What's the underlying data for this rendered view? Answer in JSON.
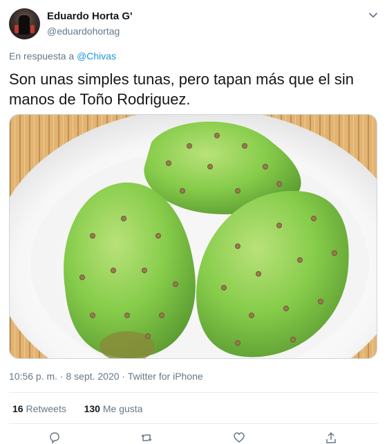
{
  "author": {
    "name": "Eduardo Horta G'",
    "handle": "@eduardohortag"
  },
  "reply": {
    "prefix": "En respuesta a",
    "mention": "@Chivas"
  },
  "tweet": {
    "text": "Son unas simples tunas, pero tapan más que el sin manos de Toño Rodriguez."
  },
  "meta": {
    "timestamp": "10:56 p. m. · 8 sept. 2020 · Twitter for iPhone"
  },
  "stats": {
    "retweets_count": "16",
    "retweets_label": "Retweets",
    "likes_count": "130",
    "likes_label": "Me gusta"
  },
  "icons": {
    "caret": "chevron-down-icon",
    "reply": "reply-icon",
    "retweet": "retweet-icon",
    "like": "heart-icon",
    "share": "share-icon"
  },
  "colors": {
    "link": "#1b95e0",
    "secondary_text": "#657786",
    "primary_text": "#14171a",
    "divider": "#e6ecf0"
  }
}
